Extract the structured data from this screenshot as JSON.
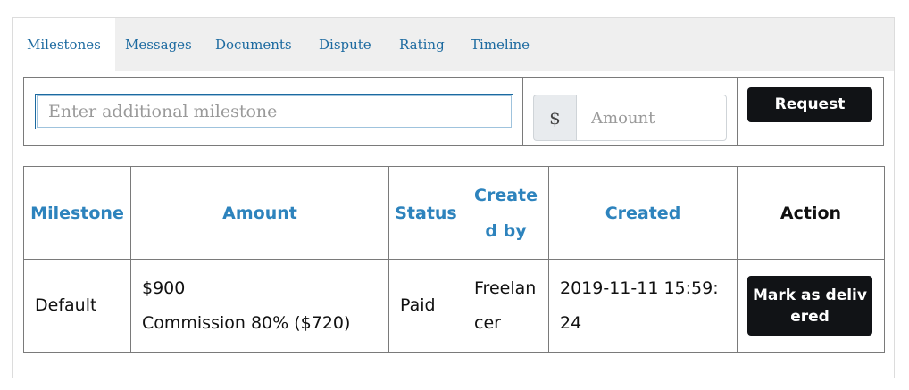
{
  "tabs": [
    {
      "label": "Milestones",
      "active": true
    },
    {
      "label": "Messages",
      "active": false
    },
    {
      "label": "Documents",
      "active": false
    },
    {
      "label": "Dispute",
      "active": false
    },
    {
      "label": "Rating",
      "active": false
    },
    {
      "label": "Timeline",
      "active": false
    }
  ],
  "request_form": {
    "milestone_placeholder": "Enter additional milestone",
    "milestone_value": "",
    "currency_symbol": "$",
    "amount_placeholder": "Amount",
    "amount_value": "",
    "request_label": "Request"
  },
  "table": {
    "headers": [
      "Milestone",
      "Amount",
      "Status",
      "Created by",
      "Created",
      "Action"
    ],
    "rows": [
      {
        "milestone": "Default",
        "amount": "$900",
        "commission": "Commission 80% ($720)",
        "status": "Paid",
        "created_by": "Freelancer",
        "created": "2019-11-11 15:59:24",
        "action_label": "Mark as delivered"
      }
    ]
  },
  "colors": {
    "tab_text": "#1c6aa0",
    "header_text": "#2d83bd",
    "button_bg": "#111316"
  }
}
